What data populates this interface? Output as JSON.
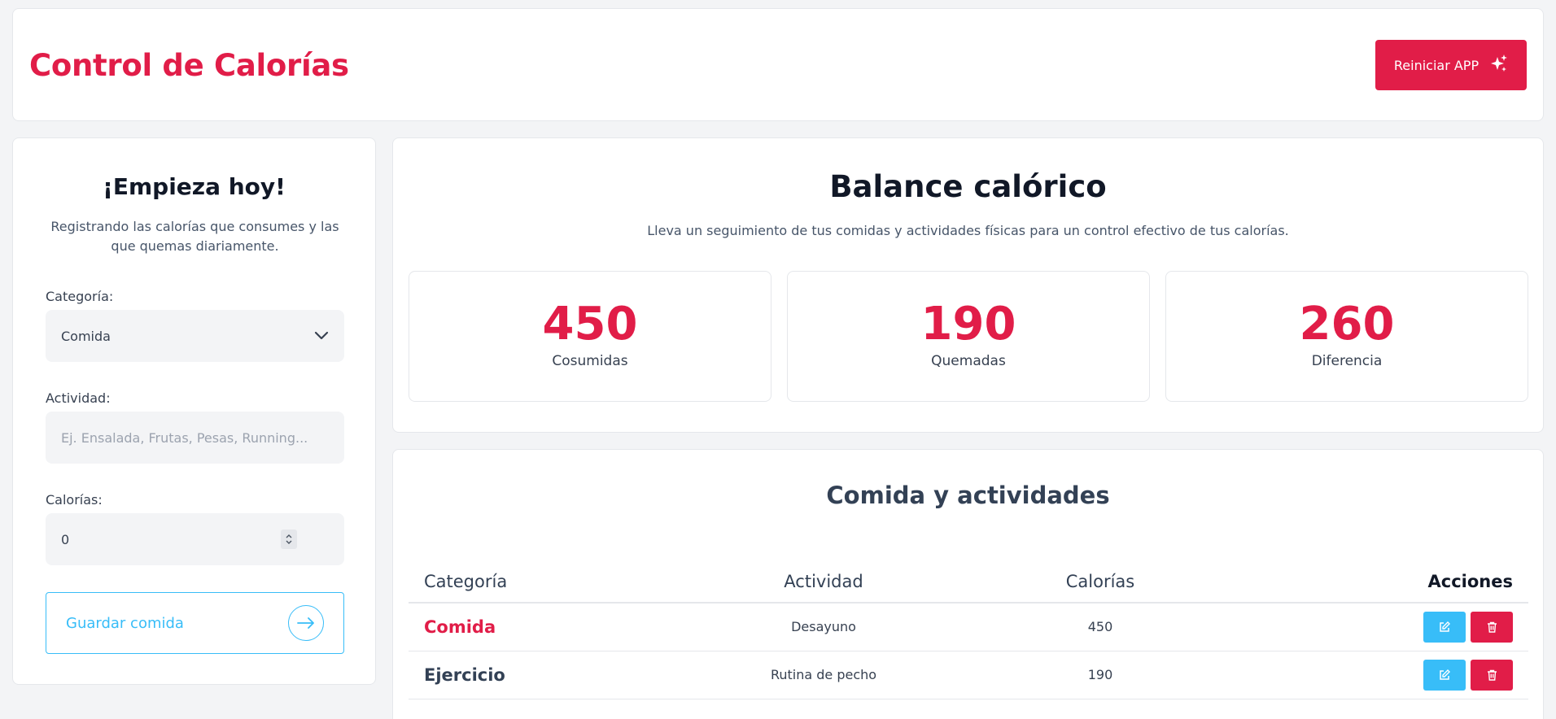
{
  "header": {
    "title": "Control de Calorías",
    "reset_label": "Reiniciar APP"
  },
  "form": {
    "title": "¡Empieza hoy!",
    "subtitle": "Registrando las calorías que consumes y las que quemas diariamente.",
    "category_label": "Categoría:",
    "category_value": "Comida",
    "activity_label": "Actividad:",
    "activity_placeholder": "Ej. Ensalada, Frutas, Pesas, Running...",
    "calories_label": "Calorías:",
    "calories_value": "0",
    "save_label": "Guardar comida"
  },
  "balance": {
    "title": "Balance calórico",
    "subtitle": "Lleva un seguimiento de tus comidas y actividades físicas para un control efectivo de tus calorías.",
    "stats": [
      {
        "value": "450",
        "label": "Cosumidas"
      },
      {
        "value": "190",
        "label": "Quemadas"
      },
      {
        "value": "260",
        "label": "Diferencia"
      }
    ]
  },
  "list": {
    "title": "Comida y actividades",
    "headers": [
      "Categoría",
      "Actividad",
      "Calorías",
      "Acciones"
    ],
    "rows": [
      {
        "category": "Comida",
        "activity": "Desayuno",
        "calories": "450",
        "category_color": "#e11d48"
      },
      {
        "category": "Ejercicio",
        "activity": "Rutina de pecho",
        "calories": "190",
        "category_color": "#334155"
      }
    ]
  },
  "colors": {
    "accent": "#e11d48",
    "secondary": "#38bdf8"
  },
  "icons": [
    "sparkles-icon",
    "chevron-down-icon",
    "stepper-icon",
    "arrow-right-icon",
    "edit-icon",
    "trash-icon"
  ]
}
